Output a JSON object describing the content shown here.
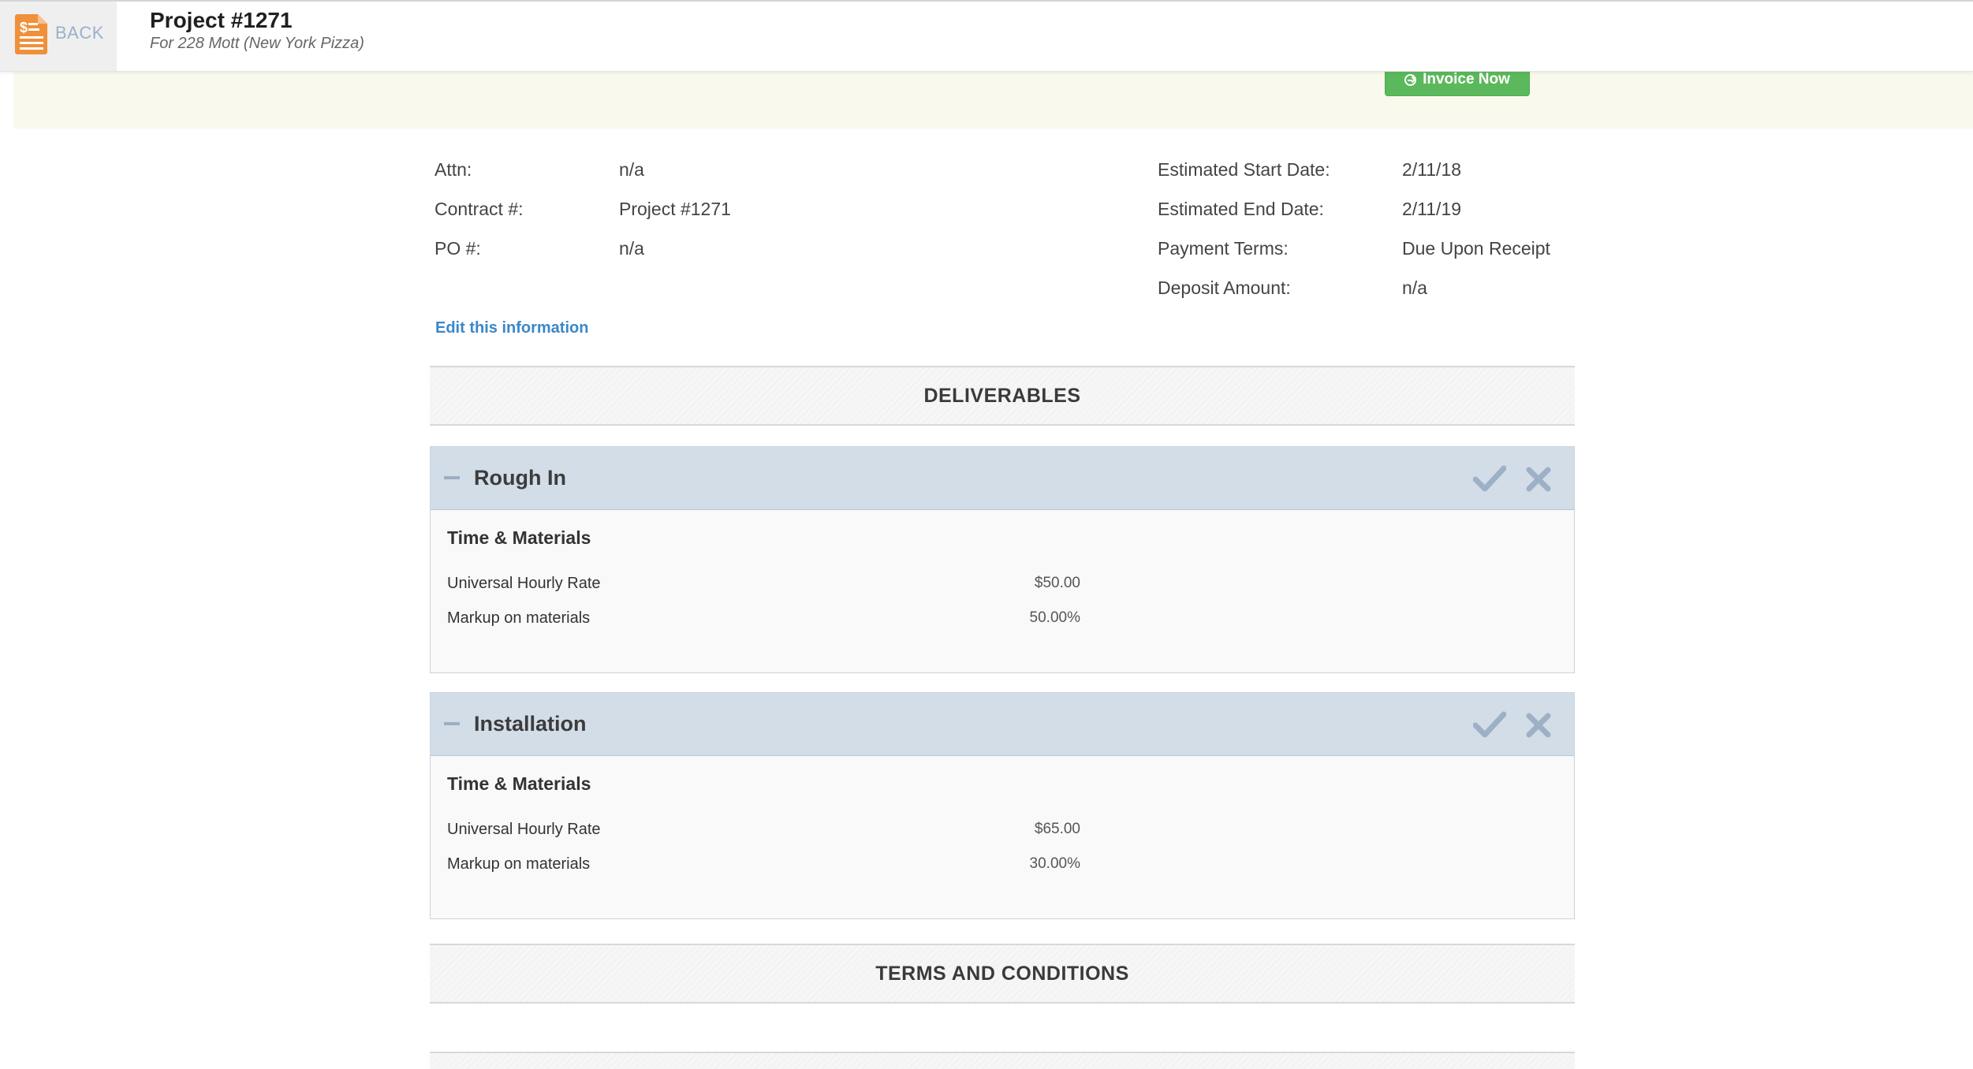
{
  "header": {
    "back_label": "BACK",
    "title": "Project #1271",
    "subtitle": "For 228 Mott (New York Pizza)"
  },
  "banner": {
    "invoice_button": "Invoice Now"
  },
  "info": {
    "left": [
      {
        "label": "Attn:",
        "value": "n/a"
      },
      {
        "label": "Contract #:",
        "value": "Project #1271"
      },
      {
        "label": "PO #:",
        "value": "n/a"
      }
    ],
    "right": [
      {
        "label": "Estimated Start Date:",
        "value": "2/11/18"
      },
      {
        "label": "Estimated End Date:",
        "value": "2/11/19"
      },
      {
        "label": "Payment Terms:",
        "value": "Due Upon Receipt"
      },
      {
        "label": "Deposit Amount:",
        "value": "n/a"
      }
    ],
    "edit_link": "Edit this information"
  },
  "sections": {
    "deliverables": "DELIVERABLES",
    "terms": "TERMS AND CONDITIONS"
  },
  "deliverables": [
    {
      "title": "Rough In",
      "billing_type": "Time & Materials",
      "rows": [
        {
          "label": "Universal Hourly Rate",
          "value": "$50.00"
        },
        {
          "label": "Markup on materials",
          "value": "50.00%"
        }
      ]
    },
    {
      "title": "Installation",
      "billing_type": "Time & Materials",
      "rows": [
        {
          "label": "Universal Hourly Rate",
          "value": "$65.00"
        },
        {
          "label": "Markup on materials",
          "value": "30.00%"
        }
      ]
    }
  ],
  "colors": {
    "invoice_button": "#5cb85c",
    "card_header": "#d3dde8",
    "link": "#3a87c8",
    "banner": "#f9f9ee",
    "back_icon": "#f0903a"
  },
  "icons": [
    "invoice-document-icon",
    "arrow-circle-right-icon",
    "minus-icon",
    "check-icon",
    "close-icon"
  ]
}
